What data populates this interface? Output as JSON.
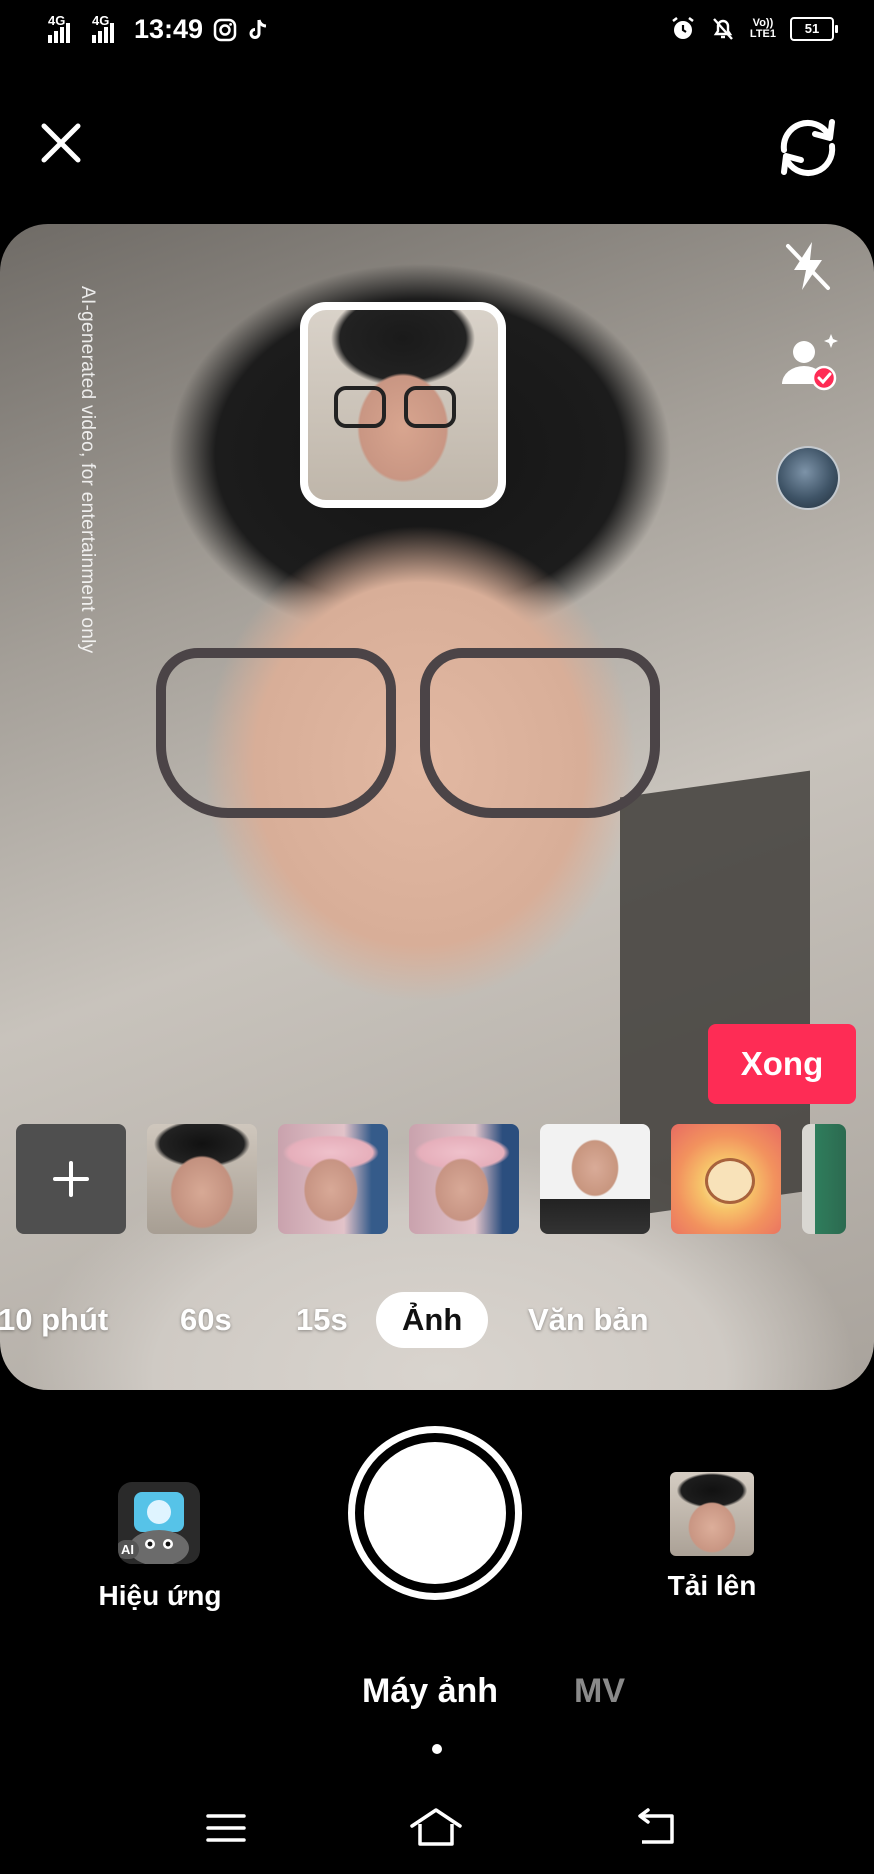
{
  "status_bar": {
    "time": "13:49",
    "network_1": "4G",
    "network_2": "4G",
    "volte_line1": "Vo))",
    "volte_line2": "LTE1",
    "battery": "51"
  },
  "camera": {
    "ai_disclaimer": "AI-generated video, for entertainment only",
    "done_label": "Xong",
    "modes": [
      "10 phút",
      "60s",
      "15s",
      "Ảnh",
      "Văn bản"
    ],
    "active_mode": "Ảnh"
  },
  "controls": {
    "effects_label": "Hiệu ứng",
    "effects_badge": "AI",
    "upload_label": "Tải lên"
  },
  "bottom_tabs": {
    "camera": "Máy ảnh",
    "mv": "MV"
  },
  "colors": {
    "accent": "#fe2c55",
    "background": "#000000"
  }
}
